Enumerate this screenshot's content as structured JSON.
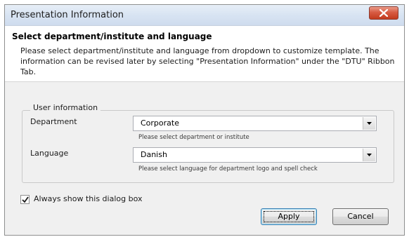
{
  "window": {
    "title": "Presentation Information"
  },
  "header": {
    "title": "Select department/institute and language",
    "description": "Please select department/institute and language from dropdown to customize template. The information can be revised later by selecting \"Presentation Information\" under the \"DTU\" Ribbon Tab."
  },
  "group": {
    "legend": "User information",
    "department": {
      "label": "Department",
      "value": "Corporate",
      "hint": "Please select department or institute"
    },
    "language": {
      "label": "Language",
      "value": "Danish",
      "hint": "Please select language for department logo and spell check"
    }
  },
  "always_show": {
    "label": "Always show this dialog box",
    "checked": true
  },
  "buttons": {
    "apply": "Apply",
    "cancel": "Cancel"
  },
  "colors": {
    "close_button": "#c33b1e",
    "title_bar": "#d7e3f2"
  }
}
